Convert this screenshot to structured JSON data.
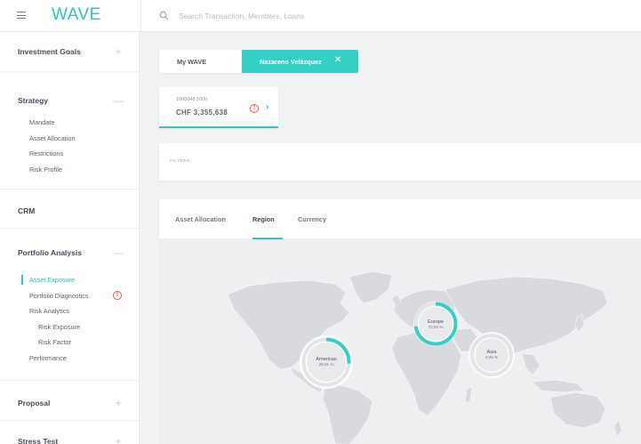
{
  "app": {
    "logo": "WAVE"
  },
  "search": {
    "placeholder": "Search Transaction, Members, Loans"
  },
  "sidebar": {
    "investment_goals": {
      "title": "Investment Goals",
      "toggle": "+"
    },
    "strategy": {
      "title": "Strategy",
      "toggle": "—",
      "items": [
        "Mandate",
        "Asset Allocation",
        "Restrictions",
        "Risk Profile"
      ]
    },
    "crm": {
      "title": "CRM"
    },
    "portfolio_analysis": {
      "title": "Portfolio Analysis",
      "toggle": "—",
      "items": [
        {
          "label": "Asset Exposure",
          "active": true
        },
        {
          "label": "Portfolio Diagnostics",
          "warning": "!"
        },
        {
          "label": "Risk Analytics"
        },
        {
          "label": "Risk Exposure",
          "level": 2
        },
        {
          "label": "Risk Factor",
          "level": 2
        },
        {
          "label": "Performance"
        }
      ]
    },
    "proposal": {
      "title": "Proposal",
      "toggle": "+"
    },
    "stress_test": {
      "title": "Stress Test",
      "toggle": "+"
    }
  },
  "client_tabs": {
    "my_wave": "My WAVE",
    "client": "Nazareno Velázquez",
    "close_icon": "✕"
  },
  "account": {
    "id": "1000048.1000",
    "amount": "CHF 3,355,638",
    "warning": "!",
    "chevron": "›"
  },
  "filters": {
    "label": "FILTERS:"
  },
  "panel": {
    "tabs": [
      {
        "label": "Asset Allocation",
        "active": false
      },
      {
        "label": "Region",
        "active": true
      },
      {
        "label": "Currency",
        "active": false
      }
    ]
  },
  "regions": [
    {
      "name": "Europe",
      "value": "72.94 %",
      "share": 0.7294
    },
    {
      "name": "Americas",
      "value": "26.01 %",
      "share": 0.2601
    },
    {
      "name": "Asia",
      "value": "0.05 %",
      "share": 0.0005
    }
  ],
  "colors": {
    "accent": "#2ec5c4",
    "tab_active_bg": "#35cfc5",
    "warning": "#e25a52",
    "map_land": "#d9dadd"
  }
}
